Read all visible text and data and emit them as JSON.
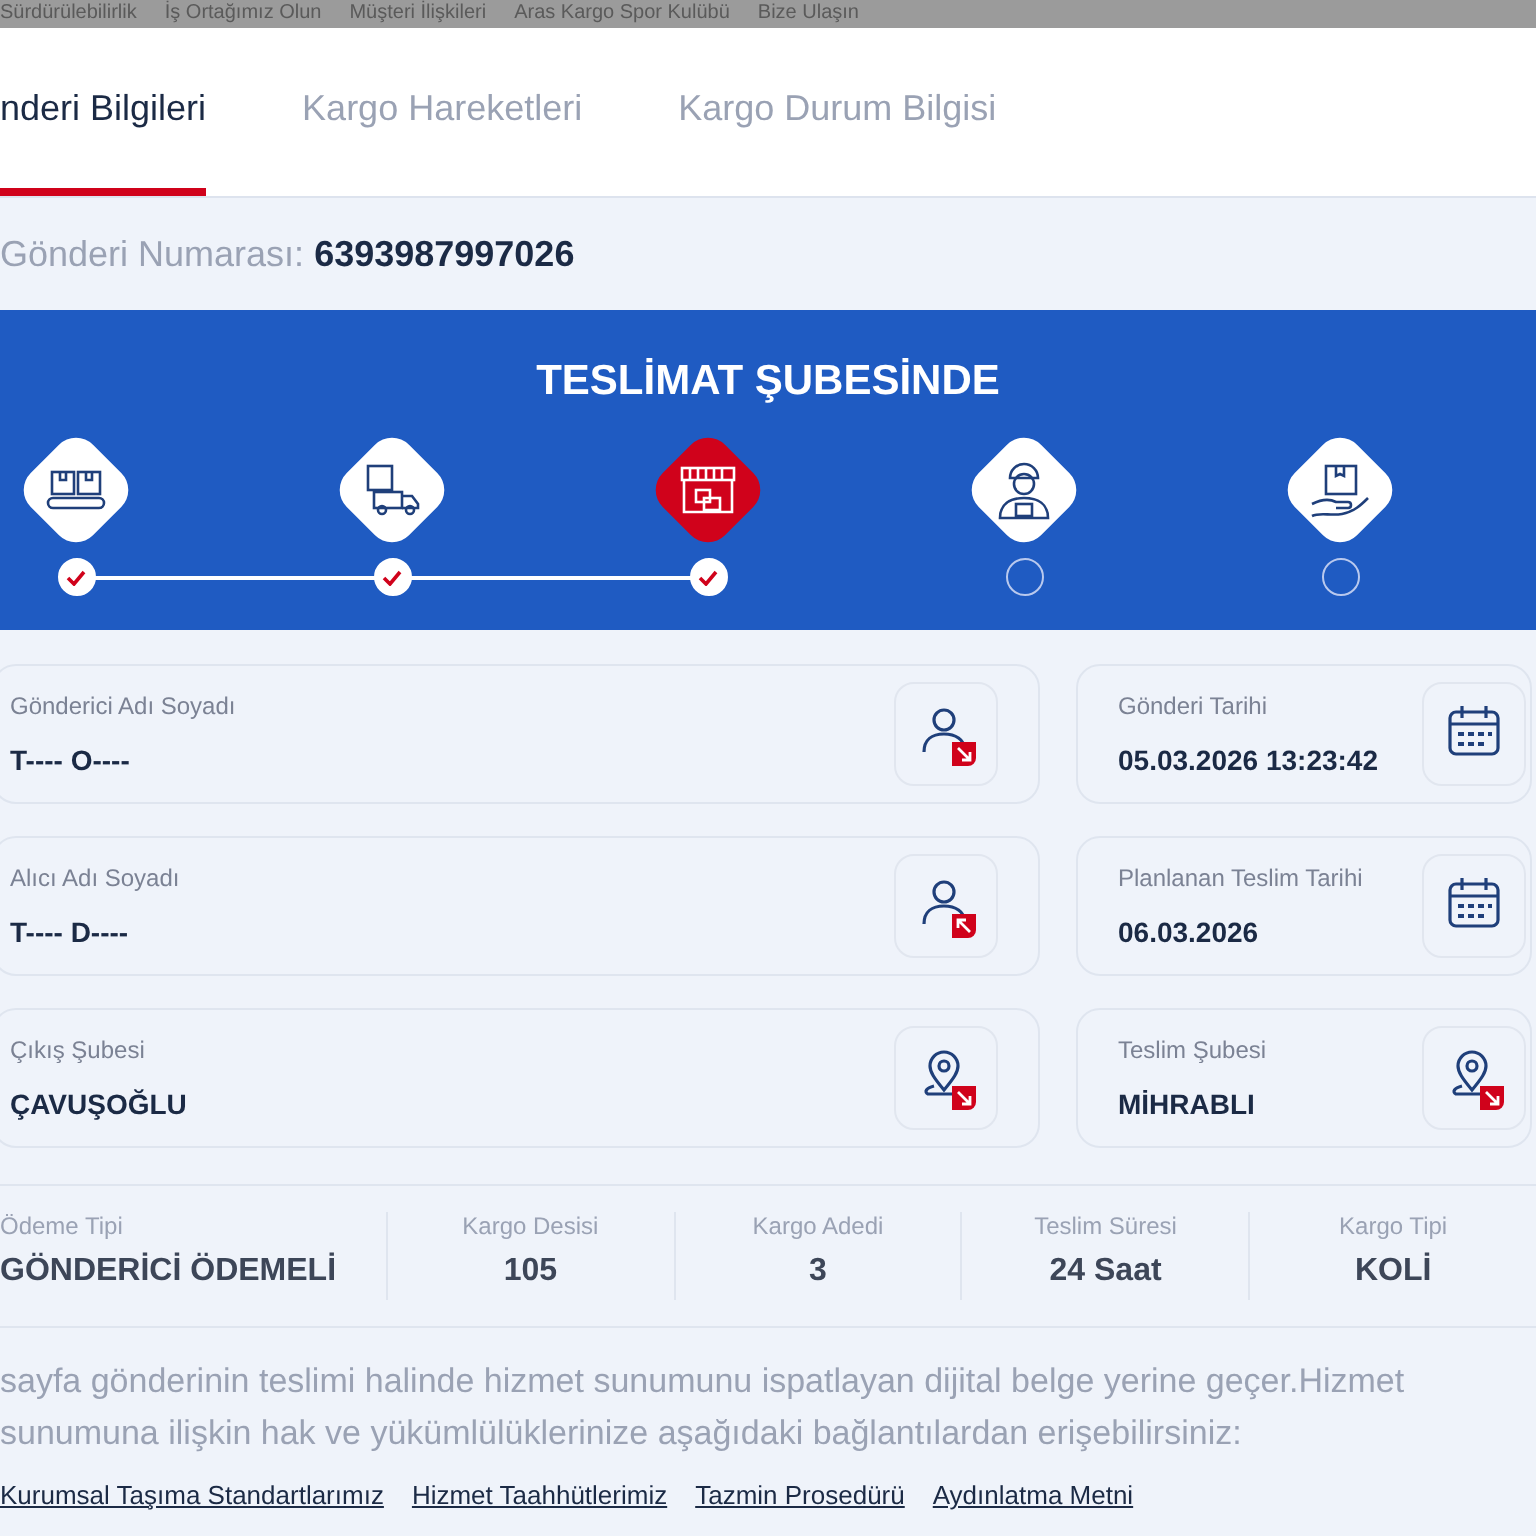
{
  "top_nav": [
    "Sürdürülebilirlik",
    "İş Ortağımız Olun",
    "Müşteri İlişkileri",
    "Aras Kargo Spor Kulübü",
    "Bize Ulaşın"
  ],
  "tabs": [
    {
      "label": "nderi Bilgileri",
      "selected": true
    },
    {
      "label": "Kargo Hareketleri",
      "selected": false
    },
    {
      "label": "Kargo Durum Bilgisi",
      "selected": false
    }
  ],
  "tracking": {
    "label": "Gönderi Numarası:",
    "value": "6393987997026"
  },
  "status": {
    "title": "TESLİMAT ŞUBESİNDE",
    "steps": [
      {
        "kind": "boxes",
        "done": true,
        "current": false
      },
      {
        "kind": "truck",
        "done": true,
        "current": false
      },
      {
        "kind": "store",
        "done": true,
        "current": true
      },
      {
        "kind": "courier",
        "done": false,
        "current": false
      },
      {
        "kind": "hand",
        "done": false,
        "current": false
      }
    ]
  },
  "cards": [
    {
      "label": "Gönderici Adı Soyadı",
      "value": "T---- O----",
      "kind": "sender"
    },
    {
      "label": "Gönderi Tarihi",
      "value": "05.03.2026 13:23:42",
      "kind": "date"
    },
    {
      "label": "Alıcı Adı Soyadı",
      "value": "T---- D----",
      "kind": "receiver"
    },
    {
      "label": "Planlanan Teslim Tarihi",
      "value": "06.03.2026",
      "kind": "date"
    },
    {
      "label": "Çıkış Şubesi",
      "value": "ÇAVUŞOĞLU",
      "kind": "location"
    },
    {
      "label": "Teslim Şubesi",
      "value": "MİHRABLI",
      "kind": "location"
    }
  ],
  "summary": [
    {
      "label": "Ödeme Tipi",
      "value": "GÖNDERİCİ ÖDEMELİ"
    },
    {
      "label": "Kargo Desisi",
      "value": "105"
    },
    {
      "label": "Kargo Adedi",
      "value": "3"
    },
    {
      "label": "Teslim Süresi",
      "value": "24 Saat"
    },
    {
      "label": "Kargo Tipi",
      "value": "KOLİ"
    }
  ],
  "notice": "sayfa gönderinin teslimi halinde hizmet sunumunu ispatlayan dijital belge yerine geçer.Hizmet sunumuna ilişkin hak ve yükümlülüklerinize aşağıdaki bağlantılardan erişebilirsiniz:",
  "links": [
    "Kurumsal Taşıma Standartlarımız",
    "Hizmet Taahhütlerimiz",
    "Tazmin Prosedürü",
    "Aydınlatma Metni"
  ]
}
